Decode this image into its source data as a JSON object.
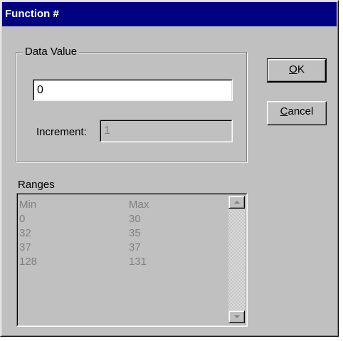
{
  "window": {
    "title": "Function #"
  },
  "data_value_group": {
    "label": "Data Value",
    "value": "0",
    "increment_label": "Increment:",
    "increment_value": "1"
  },
  "buttons": {
    "ok_label": "OK",
    "cancel_label": "Cancel"
  },
  "ranges": {
    "label": "Ranges",
    "columns": [
      "Min",
      "Max"
    ],
    "rows": [
      {
        "min": "0",
        "max": "30"
      },
      {
        "min": "32",
        "max": "35"
      },
      {
        "min": "37",
        "max": "37"
      },
      {
        "min": "128",
        "max": "131"
      }
    ],
    "scrollbar_up_icon": "arrow-up-icon",
    "scrollbar_down_icon": "arrow-down-icon"
  },
  "colors": {
    "title_bar": "#000080",
    "dialog_face": "#c0c0c0",
    "disabled_text": "#808080"
  }
}
